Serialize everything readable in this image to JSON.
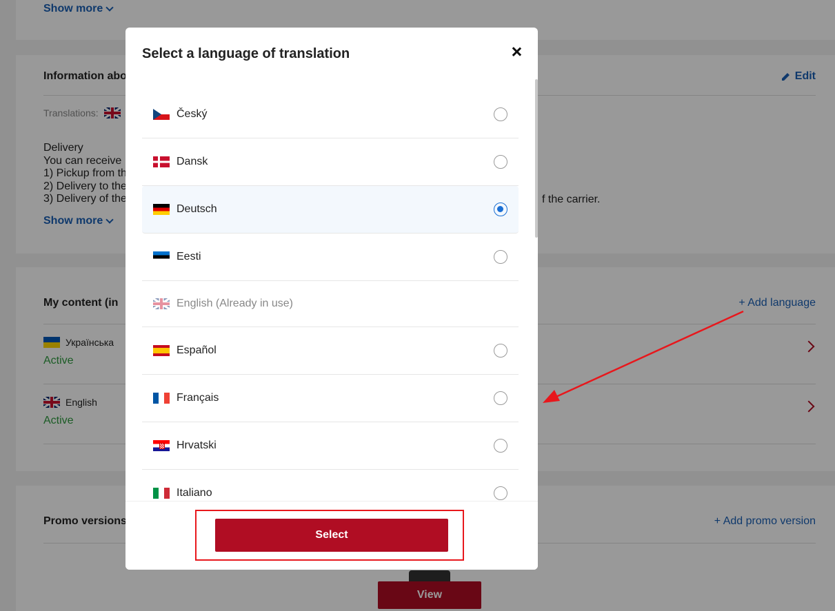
{
  "page": {
    "show_more_top": "Show more",
    "info_section": {
      "title": "Information abo",
      "edit_label": "Edit",
      "translations_label": "Translations:",
      "text_lines": [
        "Delivery",
        "You can receive",
        "1) Pickup from th",
        "2) Delivery to the",
        "3) Delivery of the"
      ],
      "text_tail": "f the carrier.",
      "show_more": "Show more"
    },
    "my_content": {
      "title": "My content (in",
      "add_language": "+ Add language",
      "rows": [
        {
          "flag": "flag-ua",
          "name": "Українська",
          "status": "Active"
        },
        {
          "flag": "flag-uk",
          "name": "English",
          "status": "Active"
        }
      ]
    },
    "promo": {
      "title": "Promo versions",
      "add_label": "+ Add promo version"
    },
    "view_button": "View"
  },
  "modal": {
    "title": "Select a language of translation",
    "languages": [
      {
        "flag": "flag-cz",
        "label": "Český",
        "selected": false,
        "disabled": false
      },
      {
        "flag": "flag-dk",
        "label": "Dansk",
        "selected": false,
        "disabled": false
      },
      {
        "flag": "flag-de",
        "label": "Deutsch",
        "selected": true,
        "disabled": false
      },
      {
        "flag": "flag-ee",
        "label": "Eesti",
        "selected": false,
        "disabled": false
      },
      {
        "flag": "flag-uk",
        "label": "English (Already in use)",
        "selected": false,
        "disabled": true
      },
      {
        "flag": "flag-es",
        "label": "Español",
        "selected": false,
        "disabled": false
      },
      {
        "flag": "flag-fr",
        "label": "Français",
        "selected": false,
        "disabled": false
      },
      {
        "flag": "flag-hr",
        "label": "Hrvatski",
        "selected": false,
        "disabled": false
      },
      {
        "flag": "flag-it",
        "label": "Italiano",
        "selected": false,
        "disabled": false
      }
    ],
    "select_button": "Select"
  },
  "colors": {
    "brand": "#b00d23",
    "link": "#1a5fb4",
    "radio_selected": "#1a6fd4",
    "active_status": "#2e9a3e",
    "annotation": "#e8171c"
  }
}
